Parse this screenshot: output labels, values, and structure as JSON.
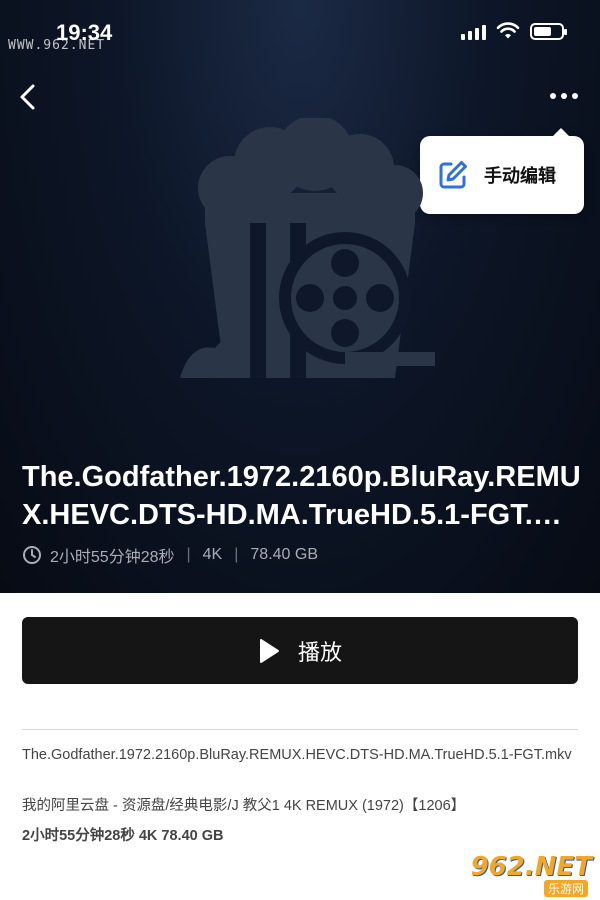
{
  "status_bar": {
    "time": "19:34"
  },
  "watermark": {
    "top": "WWW.962.NET",
    "logo": "962.NET",
    "sub": "乐游网"
  },
  "header": {
    "back_icon": "chevron-left-icon",
    "more_icon": "ellipsis-icon"
  },
  "menu": {
    "items": [
      {
        "label": "手动编辑",
        "icon": "edit-icon"
      }
    ]
  },
  "movie": {
    "title": "The.Godfather.1972.2160p.BluRay.REMUX.HEVC.DTS-HD.MA.TrueHD.5.1-FGT.mkv",
    "duration": "2小时55分钟28秒",
    "quality": "4K",
    "size": "78.40 GB"
  },
  "actions": {
    "play_label": "播放"
  },
  "file": {
    "name": "The.Godfather.1972.2160p.BluRay.REMUX.HEVC.DTS-HD.MA.TrueHD.5.1-FGT.mkv",
    "path": "我的阿里云盘 - 资源盘/经典电影/J 教父1 4K REMUX (1972)【1206】",
    "info": "2小时55分钟28秒 4K 78.40 GB"
  },
  "colors": {
    "hero_bg": "#0d1628",
    "accent": "#2f6fe4",
    "button_bg": "#151515"
  }
}
